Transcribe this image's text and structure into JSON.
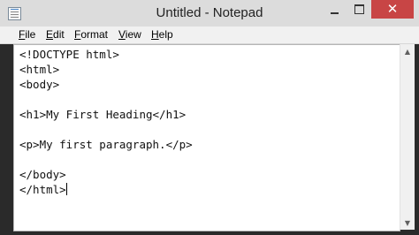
{
  "window": {
    "title": "Untitled - Notepad",
    "close_glyph": "✕"
  },
  "menu": {
    "file": {
      "underline": "F",
      "rest": "ile"
    },
    "edit": {
      "underline": "E",
      "rest": "dit"
    },
    "format": {
      "underline": "F",
      "rest": "ormat"
    },
    "view": {
      "underline": "V",
      "rest": "iew"
    },
    "help": {
      "underline": "H",
      "rest": "elp"
    }
  },
  "editor": {
    "lines": [
      "<!DOCTYPE html>",
      "<html>",
      "<body>",
      "",
      "<h1>My First Heading</h1>",
      "",
      "<p>My first paragraph.</p>",
      "",
      "</body>",
      "</html>"
    ]
  },
  "icons": {
    "app": "notepad-icon",
    "minimize": "minimize-icon",
    "maximize": "maximize-icon",
    "close": "close-icon",
    "scroll_up": "chevron-up-icon",
    "scroll_down": "chevron-down-icon"
  },
  "colors": {
    "title_bar": "#dcdcdc",
    "close_button": "#c84545",
    "editor_background": "#ffffff",
    "menu_bar": "#f1f1f1"
  }
}
